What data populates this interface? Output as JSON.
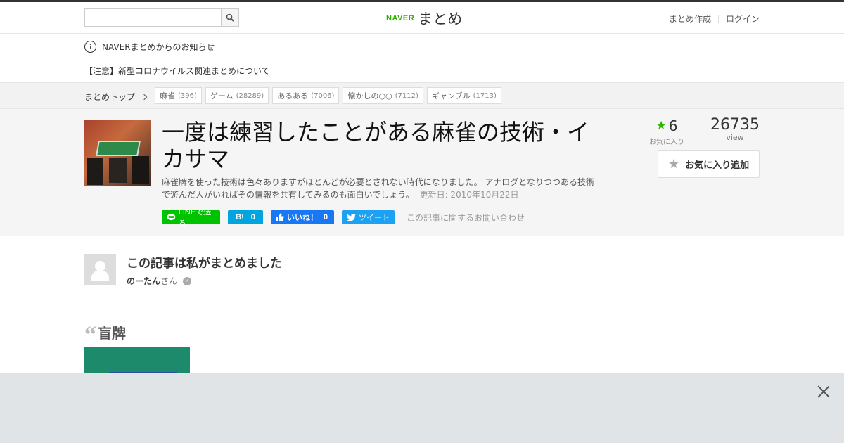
{
  "header": {
    "search_placeholder": "",
    "logo_naver": "NAVER",
    "logo_matome": "まとめ",
    "create_link": "まとめ作成",
    "login_link": "ログイン"
  },
  "notice": {
    "info_glyph": "i",
    "title": "NAVERまとめからのお知らせ",
    "message": "【注意】新型コロナウイルス関連まとめについて"
  },
  "breadcrumb": {
    "top_link": "まとめトップ",
    "tags": [
      {
        "label": "麻雀",
        "count": "(396)"
      },
      {
        "label": "ゲーム",
        "count": "(28289)"
      },
      {
        "label": "あるある",
        "count": "(7006)"
      },
      {
        "label": "懐かしの○○",
        "count": "(7112)"
      },
      {
        "label": "ギャンブル",
        "count": "(1713)"
      }
    ]
  },
  "article": {
    "title": "一度は練習したことがある麻雀の技術・イカサマ",
    "description": "麻雀牌を使った技術は色々ありますがほとんどが必要とされない時代になりました。 アナログとなりつつある技術で遊んだ人がいればその情報を共有してみるのも面白いでしょう。",
    "updated": "更新日: 2010年10月22日",
    "favorites_count": "6",
    "favorites_label": "お気に入り",
    "views_count": "26735",
    "views_label": "view",
    "fav_button_label": "お気に入り追加"
  },
  "share": {
    "line_label": "LINEで送る",
    "hatena_label": "B!",
    "hatena_count": "0",
    "fb_label": "いいね！",
    "fb_count": "0",
    "tweet_label": "ツイート",
    "contact_label": "この記事に関するお問い合わせ"
  },
  "author": {
    "heading": "この記事は私がまとめました",
    "name": "のーたん",
    "suffix": "さん"
  },
  "section": {
    "title": "盲牌"
  }
}
